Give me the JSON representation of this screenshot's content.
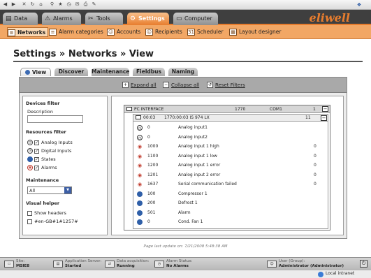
{
  "browser": {
    "icons": [
      "back-icon",
      "forward-icon",
      "stop-icon",
      "refresh-icon",
      "home-icon",
      "search-icon",
      "favorites-icon",
      "history-icon",
      "mail-icon",
      "print-icon",
      "edit-icon"
    ]
  },
  "main_tabs": [
    {
      "label": "Data",
      "icon": "data-icon"
    },
    {
      "label": "Alarms",
      "icon": "alarm-icon"
    },
    {
      "label": "Tools",
      "icon": "tools-icon"
    },
    {
      "label": "Settings",
      "icon": "settings-icon",
      "active": true
    },
    {
      "label": "Computer",
      "icon": "computer-icon"
    }
  ],
  "brand": {
    "logo": "eliwell"
  },
  "sub_nav": [
    {
      "label": "Networks",
      "active": true
    },
    {
      "label": "Alarm categories"
    },
    {
      "label": "Accounts"
    },
    {
      "label": "Recipients"
    },
    {
      "label": "Scheduler"
    },
    {
      "label": "Layout designer"
    }
  ],
  "page": {
    "title": "Settings » Networks » View"
  },
  "view_tabs": [
    {
      "label": "View",
      "active": true
    },
    {
      "label": "Discover"
    },
    {
      "label": "Maintenance"
    },
    {
      "label": "Fieldbus"
    },
    {
      "label": "Naming"
    }
  ],
  "actions": {
    "expand": "Expand all",
    "collapse": "Collapse all",
    "reset": "Reset Filters"
  },
  "filters": {
    "devices_heading": "Devices filter",
    "description_label": "Description",
    "description_value": "",
    "resources_heading": "Resources filter",
    "resources": [
      {
        "label": "Analog Inputs",
        "checked": true,
        "icon": "clock-icon"
      },
      {
        "label": "Digital Inputs",
        "checked": true,
        "icon": "clock-icon"
      },
      {
        "label": "States",
        "checked": true,
        "icon": "state-icon"
      },
      {
        "label": "Alarms",
        "checked": true,
        "icon": "alarm-icon"
      }
    ],
    "maintenance_heading": "Maintenance",
    "maintenance_value": "All",
    "visual_heading": "Visual helper",
    "show_headers": "Show headers",
    "color_code": "#en-GB#1#1257#"
  },
  "tree": {
    "interface": {
      "name": "PC INTERFACE",
      "code": "1770",
      "port": "COM1",
      "count": "1"
    },
    "device": {
      "address": "00:03",
      "id": "1770:00:03 IS 974 LX",
      "count": "11"
    },
    "rows": [
      {
        "icon": "clock",
        "id": "0",
        "name": "Analog input1",
        "value": ""
      },
      {
        "icon": "clock",
        "id": "0",
        "name": "Analog input2",
        "value": ""
      },
      {
        "icon": "alarm",
        "id": "1000",
        "name": "Analog input 1 high",
        "value": "0"
      },
      {
        "icon": "alarm",
        "id": "1100",
        "name": "Analog input 1 low",
        "value": "0"
      },
      {
        "icon": "alarm",
        "id": "1200",
        "name": "Analog input 1 error",
        "value": "0"
      },
      {
        "icon": "alarm",
        "id": "1201",
        "name": "Analog input 2 error",
        "value": "0"
      },
      {
        "icon": "alarm",
        "id": "1637",
        "name": "Serial communication failed",
        "value": "0"
      },
      {
        "icon": "state",
        "id": "100",
        "name": "Compressor 1",
        "value": ""
      },
      {
        "icon": "state",
        "id": "200",
        "name": "Defrost 1",
        "value": ""
      },
      {
        "icon": "state",
        "id": "501",
        "name": "Alarm",
        "value": ""
      },
      {
        "icon": "state",
        "id": "0",
        "name": "Cond. Fan 1",
        "value": ""
      }
    ]
  },
  "footer": {
    "updated": "Page last update on: 7/21/2008 5:48:38 AM"
  },
  "status": [
    {
      "caption": "Site:",
      "value": "MSIE8"
    },
    {
      "caption": "Application Server:",
      "value": "Started"
    },
    {
      "caption": "Data acquisition:",
      "value": "Running"
    },
    {
      "caption": "Alarm Status:",
      "value": "No Alarms"
    },
    {
      "caption": "User (Group):",
      "value": "Administrator (Administrator)"
    }
  ],
  "ie_status": {
    "zone": "Local intranet"
  },
  "colors": {
    "accent": "#e87d2e",
    "tab_bar": "#3f3f3f",
    "sub_bar": "#f2a765",
    "panel": "#ececec"
  }
}
